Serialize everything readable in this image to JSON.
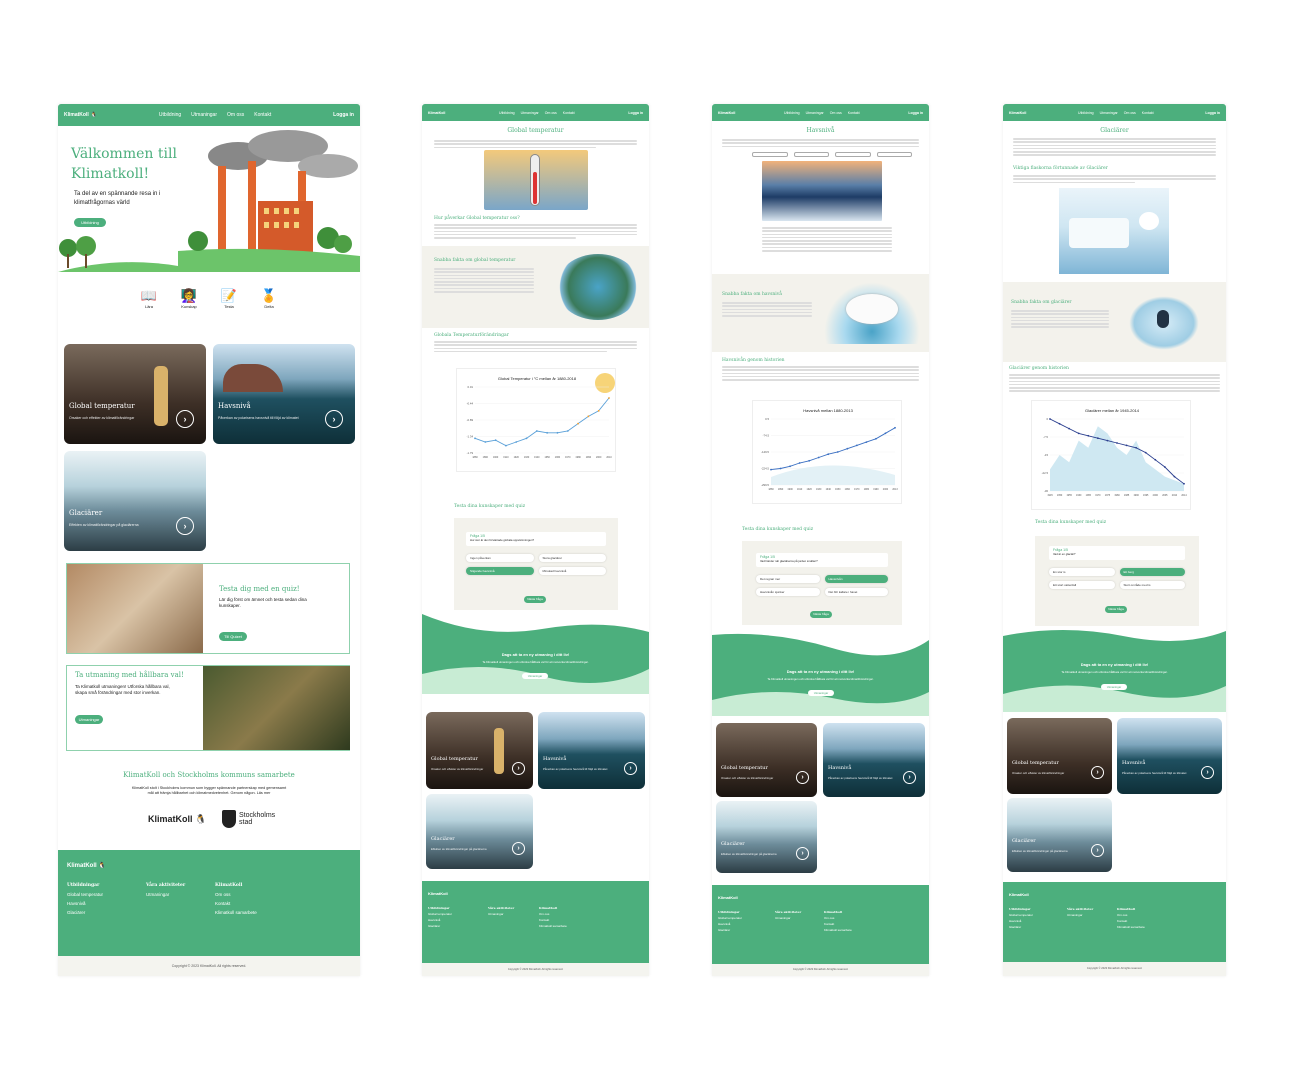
{
  "brand": {
    "name": "KlimatKoll",
    "green": "#4caf7d",
    "light_green": "#c8ecd4",
    "beige": "#f3f2ec"
  },
  "nav": {
    "items": [
      "Utbildning",
      "Utmaningar",
      "Om oss",
      "Kontakt"
    ],
    "login": "Logga in"
  },
  "home": {
    "hero_title": "Välkommen till Klimatkoll!",
    "hero_sub": "Ta del av en spännande resa in i klimatfrågornas värld",
    "hero_button": "Utbildning",
    "icons": [
      {
        "label": "Lära",
        "icon": "book-icon"
      },
      {
        "label": "Kunskap",
        "icon": "teacher-icon"
      },
      {
        "label": "Testa",
        "icon": "document-icon"
      },
      {
        "label": "Delta",
        "icon": "badge-icon"
      }
    ],
    "quiz_title": "Testa dig med en quiz!",
    "quiz_text": "Lär dig först om ämnet och testa sedan dina kunskaper.",
    "quiz_button": "Till Quizet",
    "challenge_title": "Ta utmaning med hållbara val!",
    "challenge_text": "Ta Klimatkoll utmaningen! Utforska hållbara val, skapa små förändringar med stor inverkan.",
    "challenge_button": "Utmaningar",
    "collab_title": "KlimatKoll och Stockholms kommuns samarbete",
    "collab_text": "KlimatKoll stolt i Stockholms kommun som bygger spännande partnerskap med gemensamt mål att främja hållbarhet och klimatmedvetenhet. Genom någon. Läs mer",
    "stockholm_logo": "Stockholms stad"
  },
  "cards": [
    {
      "title": "Global temperatur",
      "sub": "Orsaker och effekter av klimatförändringar"
    },
    {
      "title": "Havsnivå",
      "sub": "Påverkan av polarisens havsnivå till följd av klimatet"
    },
    {
      "title": "Glaciärer",
      "sub": "Effekten av klimatförändringar på glaciärerna"
    }
  ],
  "pages": {
    "global": {
      "title": "Global temperatur",
      "h2": "Hur påverkar Global temperatur oss?",
      "facts_title": "Snabba fakta om global temperatur",
      "chart_section": "Globala Temperaturförändringar",
      "quiz_heading": "Testa dina kunskaper med quiz"
    },
    "sea": {
      "title": "Havsnivå",
      "facts_title": "Snabba fakta om havsnivå",
      "history_title": "Havsnivån genom historien",
      "quiz_heading": "Testa dina kunskaper med quiz"
    },
    "glacier": {
      "title": "Glaciärer",
      "sub_h": "Viktiga flaskorna förtunnade av Glaciärer",
      "facts_title": "Snabba fakta om glaciärer",
      "history_title": "Glaciärer genom historien",
      "quiz_heading": "Testa dina kunskaper med quiz"
    }
  },
  "quiz": {
    "global": {
      "q_label": "Fråga 1/5",
      "question": "Hur stor är den förväntade globala uppvärmningen?",
      "answers": [
        "Ingen påverkan",
        "Stora glaciärer",
        "Stigande havsnivå",
        "Minskad havsnivå"
      ],
      "selected": 2,
      "next": "Nästa fråga"
    },
    "sea": {
      "q_label": "Fråga 1/5",
      "question": "Vad händer när glaciärerna på jorden smälter?",
      "answers": [
        "Det regnar mer",
        "Havsnivån",
        "Havsnivån sjunker",
        "Det blir kallare i havet"
      ],
      "selected": 1,
      "next": "Nästa fråga"
    },
    "glacier": {
      "q_label": "Fråga 1/5",
      "question": "Vad är en glaciär?",
      "answers": [
        "En stor is",
        "Ett berg",
        "Ett stort vattenfall",
        "Stort område med is"
      ],
      "selected": 1,
      "next": "Nästa fråga"
    }
  },
  "cta": {
    "title": "Dags att ta en ny utmaning i ditt liv!",
    "text": "Ta Klimatkoll utmaningen och utforska hållbara val för att motverka klimatförändringar.",
    "button": "Utmaningar"
  },
  "footer": {
    "logo": "KlimatKoll",
    "col1": {
      "title": "Utbildningar",
      "items": [
        "Global temperatur",
        "Havsnivå",
        "Glaciärer"
      ]
    },
    "col2": {
      "title": "Våra aktiviteter",
      "items": [
        "Utmaningar"
      ]
    },
    "col3": {
      "title": "KlimatKoll",
      "items": [
        "Om oss",
        "Kontakt",
        "Klimatkoll samarbete"
      ]
    },
    "copyright": "Copyright © 2023 KlimatKoll. All rights reserved."
  },
  "chart_data": [
    {
      "type": "line",
      "title": "Global Temperatur i °C mellan år 1880-2018",
      "x": [
        "1880",
        "1890",
        "1900",
        "1910",
        "1920",
        "1930",
        "1940",
        "1950",
        "1960",
        "1970",
        "1980",
        "1990",
        "2000",
        "2010"
      ],
      "values": [
        -0.2,
        -0.3,
        -0.25,
        -0.4,
        -0.3,
        -0.2,
        0.0,
        -0.05,
        -0.05,
        0.0,
        0.2,
        0.4,
        0.55,
        0.9
      ],
      "ylim": [
        -0.6,
        1.2
      ]
    },
    {
      "type": "line",
      "title": "Havsnivå mellan 1880-2013",
      "x": [
        "1880",
        "1890",
        "1900",
        "1910",
        "1920",
        "1930",
        "1940",
        "1950",
        "1960",
        "1970",
        "1980",
        "1990",
        "2000",
        "2013"
      ],
      "values": [
        -180,
        -175,
        -165,
        -150,
        -140,
        -125,
        -110,
        -100,
        -85,
        -70,
        -55,
        -40,
        -15,
        10
      ],
      "ylim": [
        -250,
        50
      ]
    },
    {
      "type": "line",
      "title": "Glaciärer mellan år 1945-2014",
      "x": [
        "1945",
        "1950",
        "1955",
        "1960",
        "1965",
        "1970",
        "1975",
        "1980",
        "1985",
        "1990",
        "1995",
        "2000",
        "2005",
        "2010",
        "2014"
      ],
      "values": [
        0,
        -2,
        -4,
        -6,
        -7,
        -8,
        -9,
        -10,
        -11,
        -12,
        -14,
        -17,
        -20,
        -24,
        -27
      ],
      "ylim": [
        -30,
        0
      ]
    }
  ]
}
